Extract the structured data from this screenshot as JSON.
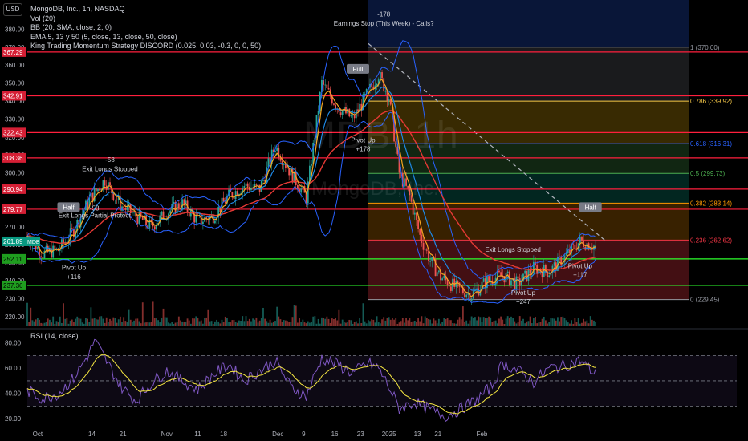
{
  "header": {
    "currency_button": "USD",
    "legend_lines": [
      "MongoDB, Inc., 1h, NASDAQ",
      "Vol (20)",
      "BB (20, SMA, close, 2, 0)",
      "EMA 5, 13 y 50 (5, close, 13, close, 50, close)",
      "King Trading Momentum Strategy DISCORD (0.025, 0.03, -0.3, 0, 0, 50)"
    ],
    "rsi_title": "RSI (14, close)"
  },
  "watermark": {
    "symbol": "MDB, 1h",
    "name": "MongoDB, Inc."
  },
  "colors": {
    "background": "#000000",
    "candle_up": "#26a69a",
    "candle_down": "#ef5350",
    "bb": "#2962ff",
    "ema5": "#f5a623",
    "ema13": "#1e88e5",
    "ema50": "#e53935",
    "rsi_line": "#7e57c2",
    "rsi_ma": "#f5e642",
    "resistance": "#ff1f3d",
    "support": "#2cff2c"
  },
  "chart_data": [
    {
      "type": "candlestick",
      "symbol": "MDB",
      "timeframe": "1h",
      "x_labels": [
        "Oct",
        "14",
        "21",
        "Nov",
        "11",
        "18",
        "Dec",
        "9",
        "16",
        "23",
        "2025",
        "13",
        "21",
        "Feb"
      ],
      "y_ticks": [
        220,
        230,
        240,
        250,
        260,
        270,
        280,
        290,
        300,
        310,
        320,
        330,
        340,
        350,
        360,
        370,
        380
      ],
      "ylim": [
        215,
        390
      ],
      "y_tick_labels": [
        "220.00",
        "230.00",
        "240.00",
        "250.00",
        "260.00",
        "270.00",
        "280.00",
        "290.00",
        "300.00",
        "310.00",
        "320.00",
        "330.00",
        "340.00",
        "350.00",
        "360.00",
        "370.00",
        "380.00"
      ],
      "price_path": [
        {
          "x": 0,
          "y": 265
        },
        {
          "x": 3,
          "y": 255
        },
        {
          "x": 6,
          "y": 257
        },
        {
          "x": 9,
          "y": 268
        },
        {
          "x": 12,
          "y": 285
        },
        {
          "x": 15,
          "y": 296
        },
        {
          "x": 18,
          "y": 282
        },
        {
          "x": 21,
          "y": 276
        },
        {
          "x": 24,
          "y": 270
        },
        {
          "x": 27,
          "y": 278
        },
        {
          "x": 30,
          "y": 283
        },
        {
          "x": 33,
          "y": 273
        },
        {
          "x": 36,
          "y": 276
        },
        {
          "x": 39,
          "y": 287
        },
        {
          "x": 42,
          "y": 293
        },
        {
          "x": 45,
          "y": 291
        },
        {
          "x": 48,
          "y": 315
        },
        {
          "x": 51,
          "y": 300
        },
        {
          "x": 54,
          "y": 286
        },
        {
          "x": 57,
          "y": 350
        },
        {
          "x": 60,
          "y": 337
        },
        {
          "x": 63,
          "y": 330
        },
        {
          "x": 66,
          "y": 345
        },
        {
          "x": 68,
          "y": 355
        },
        {
          "x": 70,
          "y": 342
        },
        {
          "x": 72,
          "y": 300
        },
        {
          "x": 74,
          "y": 287
        },
        {
          "x": 76,
          "y": 265
        },
        {
          "x": 78,
          "y": 251
        },
        {
          "x": 80,
          "y": 242
        },
        {
          "x": 83,
          "y": 236
        },
        {
          "x": 86,
          "y": 232
        },
        {
          "x": 89,
          "y": 240
        },
        {
          "x": 92,
          "y": 243
        },
        {
          "x": 95,
          "y": 238
        },
        {
          "x": 98,
          "y": 247
        },
        {
          "x": 101,
          "y": 245
        },
        {
          "x": 104,
          "y": 253
        },
        {
          "x": 107,
          "y": 262
        },
        {
          "x": 110,
          "y": 259
        }
      ],
      "price_tags": [
        {
          "value": 367.29,
          "label": "367.29",
          "type": "resistance"
        },
        {
          "value": 342.91,
          "label": "342.91",
          "type": "resistance"
        },
        {
          "value": 322.43,
          "label": "322.43",
          "type": "resistance"
        },
        {
          "value": 308.36,
          "label": "308.36",
          "type": "resistance"
        },
        {
          "value": 290.94,
          "label": "290.94",
          "type": "resistance"
        },
        {
          "value": 279.77,
          "label": "279.77",
          "type": "resistance"
        },
        {
          "value": 261.89,
          "label": "261.89",
          "type": "current",
          "ticker": "MDB"
        },
        {
          "value": 252.11,
          "label": "252.11",
          "type": "support"
        },
        {
          "value": 237.36,
          "label": "237.36",
          "type": "support"
        }
      ],
      "fibonacci": [
        {
          "level": "1",
          "price": 370.0,
          "label": "1 (370.00)"
        },
        {
          "level": "0.786",
          "price": 339.92,
          "label": "0.786 (339.92)"
        },
        {
          "level": "0.618",
          "price": 316.31,
          "label": "0.618 (316.31)"
        },
        {
          "level": "0.5",
          "price": 299.73,
          "label": "0.5 (299.73)"
        },
        {
          "level": "0.382",
          "price": 283.14,
          "label": "0.382 (283.14)"
        },
        {
          "level": "0.236",
          "price": 262.62,
          "label": "0.236 (262.62)"
        },
        {
          "level": "0",
          "price": 229.45,
          "label": "0 (229.45)"
        }
      ],
      "annotations": [
        {
          "text": "-178",
          "x": 69,
          "y": 387
        },
        {
          "text": "Earnings Stop (This Week) - Calls?",
          "x": 69,
          "y": 382
        },
        {
          "text": "-58",
          "x": 16,
          "y": 306
        },
        {
          "text": "Exit Longs Stopped",
          "x": 16,
          "y": 301
        },
        {
          "text": "-58",
          "x": 13,
          "y": 279
        },
        {
          "text": "Exit Longs Partial Protect",
          "x": 13,
          "y": 275
        },
        {
          "text": "Full",
          "x": 64,
          "y": 357,
          "badge": true
        },
        {
          "text": "Pivot Up",
          "x": 65,
          "y": 317
        },
        {
          "text": "+178",
          "x": 65,
          "y": 312
        },
        {
          "text": "Half",
          "x": 8,
          "y": 280,
          "badge": true
        },
        {
          "text": "Pivot Up",
          "x": 9,
          "y": 246
        },
        {
          "text": "+116",
          "x": 9,
          "y": 241
        },
        {
          "text": "Exit Longs Stopped",
          "x": 94,
          "y": 256
        },
        {
          "text": "Half",
          "x": 109,
          "y": 280,
          "badge": true
        },
        {
          "text": "Pivot Up",
          "x": 107,
          "y": 247
        },
        {
          "text": "+117",
          "x": 107,
          "y": 242
        },
        {
          "text": "Pivot Up",
          "x": 96,
          "y": 232
        },
        {
          "text": "+247",
          "x": 96,
          "y": 227
        }
      ]
    },
    {
      "type": "line",
      "title": "RSI (14, close)",
      "y_ticks": [
        20,
        40,
        60,
        80
      ],
      "y_tick_labels": [
        "20.00",
        "40.00",
        "60.00",
        "80.00"
      ],
      "ylim": [
        15,
        90
      ],
      "bands": [
        30,
        50,
        70
      ],
      "series": [
        {
          "values": [
            {
              "x": 0,
              "y": 42
            },
            {
              "x": 3,
              "y": 36
            },
            {
              "x": 6,
              "y": 40
            },
            {
              "x": 9,
              "y": 52
            },
            {
              "x": 12,
              "y": 72
            },
            {
              "x": 13,
              "y": 82
            },
            {
              "x": 15,
              "y": 68
            },
            {
              "x": 18,
              "y": 46
            },
            {
              "x": 21,
              "y": 34
            },
            {
              "x": 24,
              "y": 48
            },
            {
              "x": 27,
              "y": 58
            },
            {
              "x": 30,
              "y": 50
            },
            {
              "x": 33,
              "y": 43
            },
            {
              "x": 36,
              "y": 55
            },
            {
              "x": 39,
              "y": 63
            },
            {
              "x": 42,
              "y": 50
            },
            {
              "x": 45,
              "y": 58
            },
            {
              "x": 48,
              "y": 66
            },
            {
              "x": 51,
              "y": 45
            },
            {
              "x": 54,
              "y": 38
            },
            {
              "x": 57,
              "y": 68
            },
            {
              "x": 60,
              "y": 63
            },
            {
              "x": 63,
              "y": 56
            },
            {
              "x": 66,
              "y": 64
            },
            {
              "x": 68,
              "y": 60
            },
            {
              "x": 70,
              "y": 45
            },
            {
              "x": 72,
              "y": 28
            },
            {
              "x": 75,
              "y": 33
            },
            {
              "x": 78,
              "y": 27
            },
            {
              "x": 81,
              "y": 22
            },
            {
              "x": 84,
              "y": 28
            },
            {
              "x": 87,
              "y": 35
            },
            {
              "x": 90,
              "y": 46
            },
            {
              "x": 92,
              "y": 64
            },
            {
              "x": 95,
              "y": 58
            },
            {
              "x": 98,
              "y": 49
            },
            {
              "x": 101,
              "y": 60
            },
            {
              "x": 104,
              "y": 62
            },
            {
              "x": 107,
              "y": 66
            },
            {
              "x": 110,
              "y": 55
            }
          ]
        }
      ]
    }
  ]
}
